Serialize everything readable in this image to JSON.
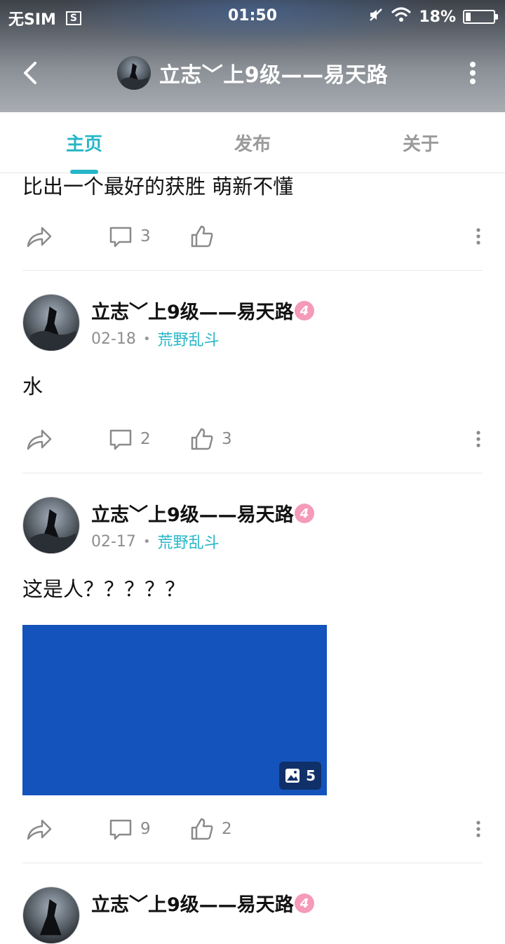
{
  "status_bar": {
    "carrier": "无SIM",
    "sim_icon_glyph": "S",
    "time": "01:50",
    "battery": "18%",
    "icons": [
      "sim-card-icon",
      "mute-icon",
      "wifi-icon",
      "battery-icon"
    ]
  },
  "nav": {
    "title": "立志﹀上9级——易天路",
    "back_icon": "back-arrow-icon",
    "more_icon": "more-vertical-icon"
  },
  "tabs": [
    {
      "label": "主页",
      "active": true
    },
    {
      "label": "发布",
      "active": false
    },
    {
      "label": "关于",
      "active": false
    }
  ],
  "feed": {
    "partial_post": {
      "text": "比出一个最好的获胜 萌新不懂",
      "comments": "3",
      "likes": ""
    },
    "posts": [
      {
        "author": "立志﹀上9级——易天路",
        "level": "4",
        "date": "02-18",
        "topic": "荒野乱斗",
        "text": "水",
        "comments": "2",
        "likes": "3"
      },
      {
        "author": "立志﹀上9级——易天路",
        "level": "4",
        "date": "02-17",
        "topic": "荒野乱斗",
        "text": "这是人？？？？？",
        "image_count": "5",
        "image_color": "#1453bb",
        "comments": "9",
        "likes": "2"
      },
      {
        "author": "立志﹀上9级——易天路",
        "level": "4"
      }
    ]
  },
  "colors": {
    "accent": "#26b6c7",
    "level_badge": "#f59ab8",
    "meta_gray": "#8e8e8e"
  }
}
